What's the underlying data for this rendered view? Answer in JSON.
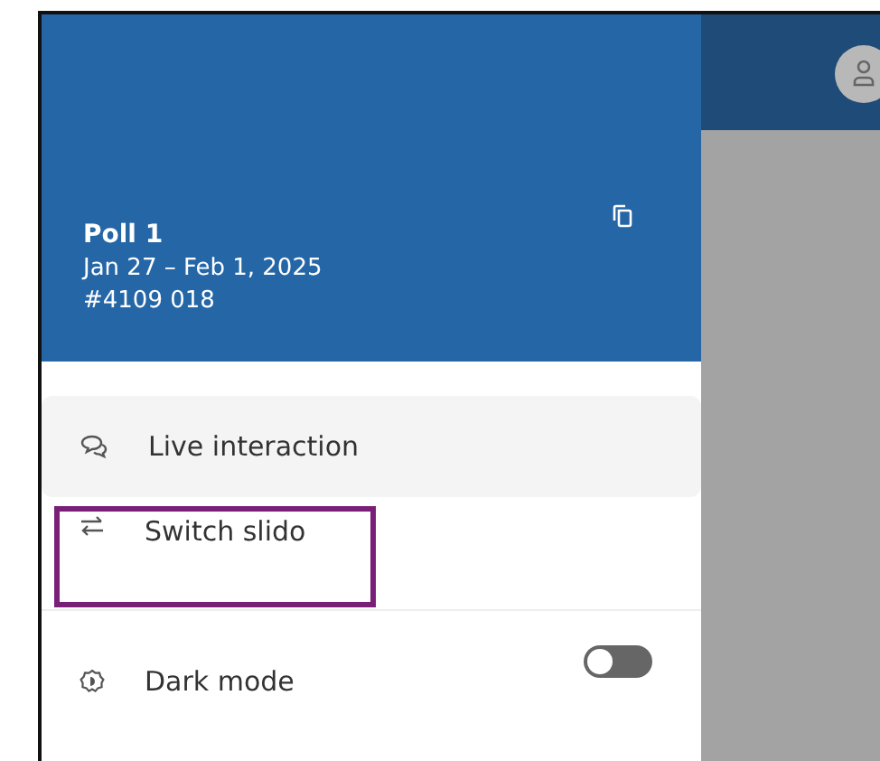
{
  "poll": {
    "title": "Poll 1",
    "dates": "Jan 27 – Feb 1, 2025",
    "code": "#4109 018"
  },
  "menu": [
    {
      "kind": "chat",
      "label": "Live interaction",
      "selected": true,
      "highlighted": false
    },
    {
      "kind": "switch",
      "label": "Switch slido",
      "selected": false,
      "highlighted": true
    }
  ],
  "dark_mode": {
    "label": "Dark mode",
    "on": false
  }
}
